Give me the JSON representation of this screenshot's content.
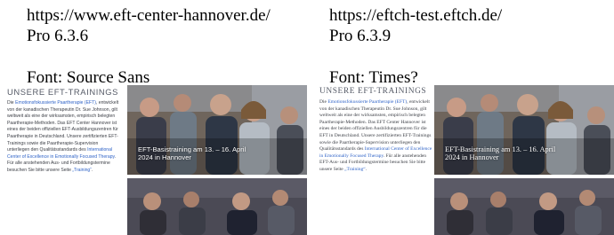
{
  "left": {
    "url": "https://www.eft-center-hannover.de/",
    "version": "Pro 6.3.6",
    "font_note": "Font: Source Sans",
    "heading": "UNSERE EFT-TRAININGS",
    "paragraph": {
      "prefix": "Die ",
      "link1": "Emotionsfokussierte Paartherapie (EFT)",
      "after1": ", entwickelt von der kanadischen Therapeutin Dr. Sue Johnson, gilt weltweit als eine der wirksamsten, empirisch belegten Paartherapie-Methoden. Das EFT Center Hannover ist eines der beiden offiziellen EFT-Ausbildungszentren für Paartherapie in Deutschland. Unsere zertifizierten EFT-Trainings sowie die Paartherapie-Supervision unterliegen den Qualitätsstandards des ",
      "link2": "International Center of Excellence in Emotionally Focused Therapy",
      "after2": ". Für alle anstehenden Aus- und Fortbildungstermine besuchen Sie bitte unsere Seite ",
      "link3": "„Training“",
      "suffix": "."
    },
    "caption": "EFT-Basistraining am 13. – 16. April 2024 in Hannover"
  },
  "right": {
    "url": "https://eftch-test.eftch.de/",
    "version": "Pro 6.3.9",
    "font_note": "Font: Times?",
    "heading": "UNSERE EFT-TRAININGS",
    "paragraph": {
      "prefix": "Die ",
      "link1": "Emotionsfokussierte Paartherapie (EFT)",
      "after1": ", entwickelt von der kanadischen Therapeutin Dr. Sue Johnson, gilt weltweit als eine der wirksamsten, empirisch belegten Paartherapie-Methoden. Das EFT Center Hannover ist eines der beiden offiziellen Ausbildungszentren für die EFT in Deutschland. Unsere zertifizierten EFT-Trainings sowie die Paartherapie-Supervision unterliegen den Qualitätsstandards des ",
      "link2": "International Center of Excellence in Emotionally Focused Therapy",
      "after2": ". Für alle anstehenden EFT-Aus- und Fortbildungstermine besuchen Sie bitte unsere Seite ",
      "link3": "„Training“",
      "suffix": "."
    },
    "caption": "EFT-Basistraining am 13. – 16. April 2024 in Hannover"
  }
}
